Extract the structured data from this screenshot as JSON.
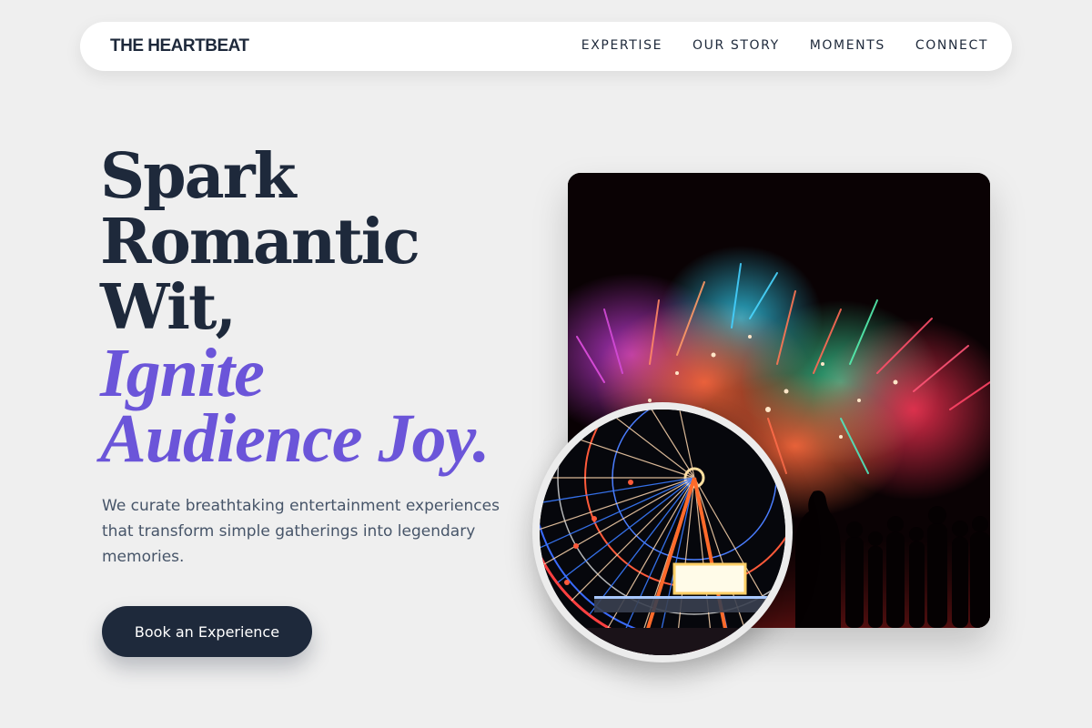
{
  "brand": "THE HEARTBEAT",
  "nav": {
    "links": [
      "EXPERTISE",
      "OUR STORY",
      "MOMENTS",
      "CONNECT"
    ]
  },
  "hero": {
    "headline_lines": [
      "Spark",
      "Romantic",
      "Wit,"
    ],
    "accent_lines": [
      "Ignite",
      "Audience Joy."
    ],
    "description": "We curate breathtaking entertainment experiences that transform simple gatherings into legendary memories.",
    "cta_label": "Book an Experience"
  },
  "colors": {
    "background": "#efefef",
    "text_dark": "#1e293b",
    "accent": "#6b55d9",
    "muted_text": "#475569",
    "button_bg": "#1e293b"
  },
  "images": {
    "main": "fireworks-photo",
    "inset": "ferris-wheel-photo"
  }
}
